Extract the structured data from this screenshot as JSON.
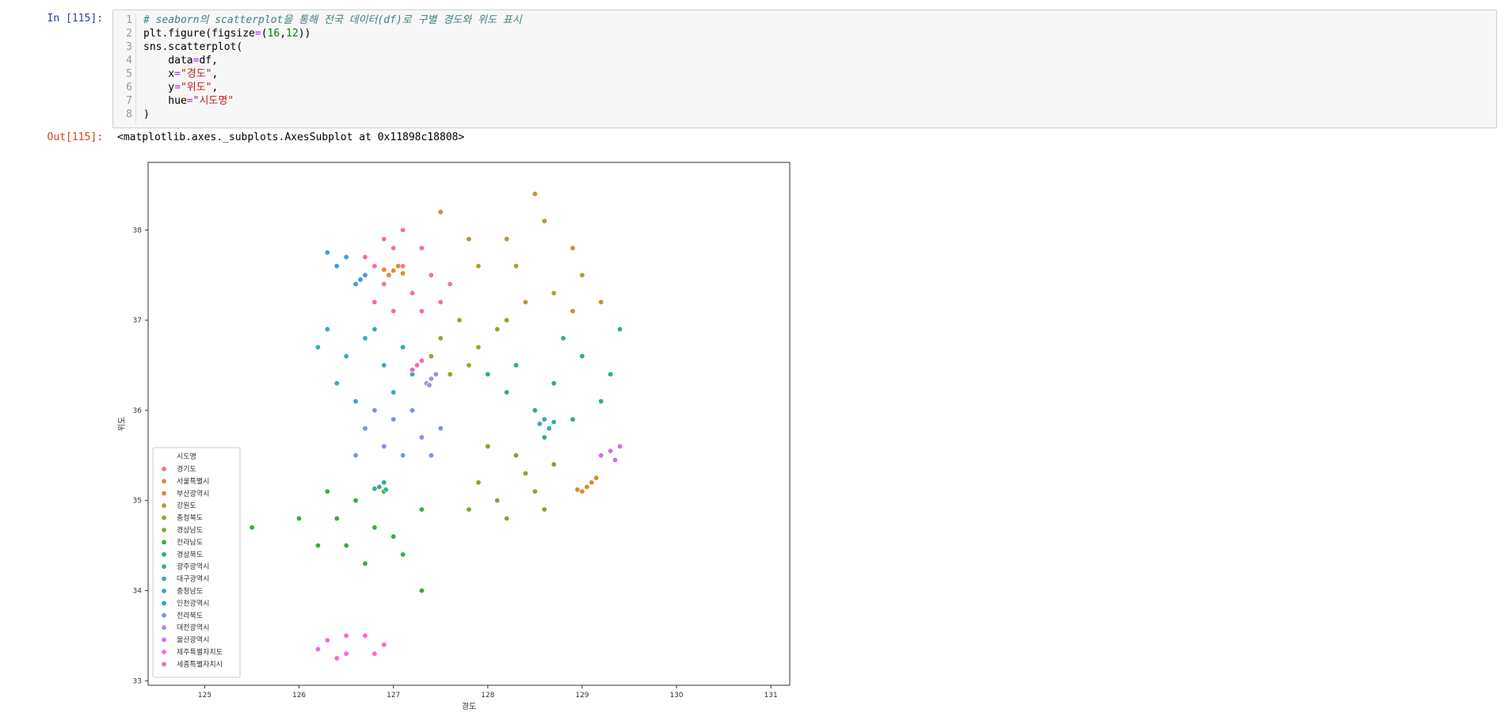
{
  "cell": {
    "in_prompt": "In [115]:",
    "out_prompt": "Out[115]:",
    "output_text": "<matplotlib.axes._subplots.AxesSubplot at 0x11898c18808>",
    "code_lines": [
      {
        "n": "1",
        "parts": [
          {
            "t": "# seaborn의 scatterplot을 통해 전국 데이터(df)로 구별 경도와 위도 표시",
            "c": "cmt"
          }
        ]
      },
      {
        "n": "2",
        "parts": [
          {
            "t": "plt.figure(figsize",
            "c": ""
          },
          {
            "t": "=",
            "c": "op"
          },
          {
            "t": "(",
            "c": ""
          },
          {
            "t": "16",
            "c": "num"
          },
          {
            "t": ",",
            "c": ""
          },
          {
            "t": "12",
            "c": "num"
          },
          {
            "t": "))",
            "c": ""
          }
        ]
      },
      {
        "n": "3",
        "parts": [
          {
            "t": "sns.scatterplot(",
            "c": ""
          }
        ]
      },
      {
        "n": "4",
        "parts": [
          {
            "t": "    data",
            "c": ""
          },
          {
            "t": "=",
            "c": "op"
          },
          {
            "t": "df,",
            "c": ""
          }
        ]
      },
      {
        "n": "5",
        "parts": [
          {
            "t": "    x",
            "c": ""
          },
          {
            "t": "=",
            "c": "op"
          },
          {
            "t": "\"경도\"",
            "c": "str"
          },
          {
            "t": ",",
            "c": ""
          }
        ]
      },
      {
        "n": "6",
        "parts": [
          {
            "t": "    y",
            "c": ""
          },
          {
            "t": "=",
            "c": "op"
          },
          {
            "t": "\"위도\"",
            "c": "str"
          },
          {
            "t": ",",
            "c": ""
          }
        ]
      },
      {
        "n": "7",
        "parts": [
          {
            "t": "    hue",
            "c": ""
          },
          {
            "t": "=",
            "c": "op"
          },
          {
            "t": "\"시도명\"",
            "c": "str"
          }
        ]
      },
      {
        "n": "8",
        "parts": [
          {
            "t": ")",
            "c": ""
          }
        ]
      }
    ]
  },
  "chart_data": {
    "type": "scatter",
    "xlabel": "경도",
    "ylabel": "위도",
    "xlim": [
      124.4,
      131.2
    ],
    "ylim": [
      32.95,
      38.75
    ],
    "xticks": [
      125,
      126,
      127,
      128,
      129,
      130,
      131
    ],
    "yticks": [
      33,
      34,
      35,
      36,
      37,
      38
    ],
    "grid": false,
    "legend_title": "시도명",
    "legend_position": "lower-left",
    "series": [
      {
        "name": "경기도",
        "color": "#f77189",
        "points": [
          [
            126.7,
            37.7
          ],
          [
            126.9,
            37.9
          ],
          [
            127.1,
            38.0
          ],
          [
            127.3,
            37.8
          ],
          [
            127.4,
            37.5
          ],
          [
            127.2,
            37.3
          ],
          [
            127.0,
            37.1
          ],
          [
            126.8,
            37.2
          ],
          [
            127.5,
            37.2
          ],
          [
            127.6,
            37.4
          ],
          [
            126.9,
            37.4
          ],
          [
            127.1,
            37.6
          ],
          [
            127.3,
            37.1
          ],
          [
            127.0,
            37.8
          ],
          [
            126.8,
            37.6
          ]
        ]
      },
      {
        "name": "서울특별시",
        "color": "#e08a31",
        "points": [
          [
            127.0,
            37.55
          ],
          [
            126.95,
            37.5
          ],
          [
            127.05,
            37.6
          ],
          [
            126.9,
            37.56
          ],
          [
            127.1,
            37.52
          ]
        ]
      },
      {
        "name": "부산광역시",
        "color": "#d28f30",
        "points": [
          [
            129.05,
            35.15
          ],
          [
            129.1,
            35.2
          ],
          [
            129.0,
            35.1
          ],
          [
            129.15,
            35.25
          ],
          [
            128.95,
            35.12
          ]
        ]
      },
      {
        "name": "강원도",
        "color": "#b39a31",
        "points": [
          [
            128.5,
            38.4
          ],
          [
            128.6,
            38.1
          ],
          [
            128.9,
            37.8
          ],
          [
            129.0,
            37.5
          ],
          [
            128.7,
            37.3
          ],
          [
            128.3,
            37.6
          ],
          [
            127.8,
            37.9
          ],
          [
            128.2,
            37.9
          ],
          [
            127.5,
            38.2
          ],
          [
            129.2,
            37.2
          ],
          [
            128.9,
            37.1
          ],
          [
            127.9,
            37.6
          ],
          [
            128.4,
            37.2
          ]
        ]
      },
      {
        "name": "충청북도",
        "color": "#9aa331",
        "points": [
          [
            127.5,
            36.8
          ],
          [
            127.7,
            37.0
          ],
          [
            127.9,
            36.7
          ],
          [
            128.1,
            36.9
          ],
          [
            127.6,
            36.4
          ],
          [
            127.8,
            36.5
          ],
          [
            128.2,
            37.0
          ],
          [
            127.4,
            36.6
          ]
        ]
      },
      {
        "name": "경상남도",
        "color": "#7aa932",
        "points": [
          [
            127.9,
            35.2
          ],
          [
            128.1,
            35.0
          ],
          [
            128.4,
            35.3
          ],
          [
            128.6,
            34.9
          ],
          [
            128.2,
            34.8
          ],
          [
            127.8,
            34.9
          ],
          [
            128.5,
            35.1
          ],
          [
            128.7,
            35.4
          ],
          [
            128.3,
            35.5
          ],
          [
            128.0,
            35.6
          ]
        ]
      },
      {
        "name": "전라남도",
        "color": "#38ab3c",
        "points": [
          [
            126.4,
            34.8
          ],
          [
            126.6,
            35.0
          ],
          [
            126.8,
            34.7
          ],
          [
            126.5,
            34.5
          ],
          [
            127.0,
            34.6
          ],
          [
            127.3,
            34.9
          ],
          [
            126.3,
            35.1
          ],
          [
            126.7,
            34.3
          ],
          [
            127.1,
            34.4
          ],
          [
            125.5,
            34.7
          ],
          [
            126.0,
            34.8
          ],
          [
            126.9,
            35.1
          ],
          [
            126.2,
            34.5
          ],
          [
            127.3,
            34.0
          ]
        ]
      },
      {
        "name": "경상북도",
        "color": "#34ad78",
        "points": [
          [
            128.5,
            36.0
          ],
          [
            128.7,
            36.3
          ],
          [
            129.0,
            36.6
          ],
          [
            128.3,
            36.5
          ],
          [
            129.2,
            36.1
          ],
          [
            128.9,
            35.9
          ],
          [
            128.2,
            36.2
          ],
          [
            129.3,
            36.4
          ],
          [
            128.6,
            35.7
          ],
          [
            129.4,
            36.9
          ],
          [
            128.8,
            36.8
          ],
          [
            128.0,
            36.4
          ]
        ]
      },
      {
        "name": "광주광역시",
        "color": "#36ad9c",
        "points": [
          [
            126.85,
            35.15
          ],
          [
            126.9,
            35.2
          ],
          [
            126.8,
            35.13
          ],
          [
            126.92,
            35.12
          ]
        ]
      },
      {
        "name": "대구광역시",
        "color": "#38aab1",
        "points": [
          [
            128.6,
            35.9
          ],
          [
            128.55,
            35.85
          ],
          [
            128.7,
            35.87
          ],
          [
            128.65,
            35.8
          ]
        ]
      },
      {
        "name": "충청남도",
        "color": "#3aa6c0",
        "points": [
          [
            126.5,
            36.6
          ],
          [
            126.7,
            36.8
          ],
          [
            126.9,
            36.5
          ],
          [
            127.1,
            36.7
          ],
          [
            126.4,
            36.3
          ],
          [
            126.6,
            36.1
          ],
          [
            127.0,
            36.2
          ],
          [
            126.3,
            36.9
          ],
          [
            126.2,
            36.7
          ],
          [
            127.2,
            36.4
          ],
          [
            126.8,
            36.9
          ]
        ]
      },
      {
        "name": "인천광역시",
        "color": "#3b9fd6",
        "points": [
          [
            126.65,
            37.45
          ],
          [
            126.7,
            37.5
          ],
          [
            126.5,
            37.7
          ],
          [
            126.3,
            37.75
          ],
          [
            126.6,
            37.4
          ],
          [
            126.4,
            37.6
          ]
        ]
      },
      {
        "name": "전라북도",
        "color": "#7a8fec",
        "points": [
          [
            126.7,
            35.8
          ],
          [
            127.0,
            35.9
          ],
          [
            127.3,
            35.7
          ],
          [
            126.9,
            35.6
          ],
          [
            127.2,
            36.0
          ],
          [
            126.6,
            35.5
          ],
          [
            127.5,
            35.8
          ],
          [
            127.1,
            35.5
          ],
          [
            126.8,
            36.0
          ],
          [
            127.4,
            35.5
          ]
        ]
      },
      {
        "name": "대전광역시",
        "color": "#a58be6",
        "points": [
          [
            127.4,
            36.35
          ],
          [
            127.35,
            36.3
          ],
          [
            127.45,
            36.4
          ],
          [
            127.38,
            36.28
          ]
        ]
      },
      {
        "name": "울산광역시",
        "color": "#d56bf0",
        "points": [
          [
            129.3,
            35.55
          ],
          [
            129.4,
            35.6
          ],
          [
            129.2,
            35.5
          ],
          [
            129.35,
            35.45
          ]
        ]
      },
      {
        "name": "제주특별자치도",
        "color": "#f468d6",
        "points": [
          [
            126.5,
            33.5
          ],
          [
            126.3,
            33.45
          ],
          [
            126.7,
            33.5
          ],
          [
            126.9,
            33.4
          ],
          [
            126.2,
            33.35
          ],
          [
            126.8,
            33.3
          ],
          [
            126.5,
            33.3
          ],
          [
            126.4,
            33.25
          ]
        ]
      },
      {
        "name": "세종특별자치시",
        "color": "#f76aaa",
        "points": [
          [
            127.25,
            36.5
          ],
          [
            127.3,
            36.55
          ],
          [
            127.2,
            36.45
          ]
        ]
      }
    ]
  }
}
